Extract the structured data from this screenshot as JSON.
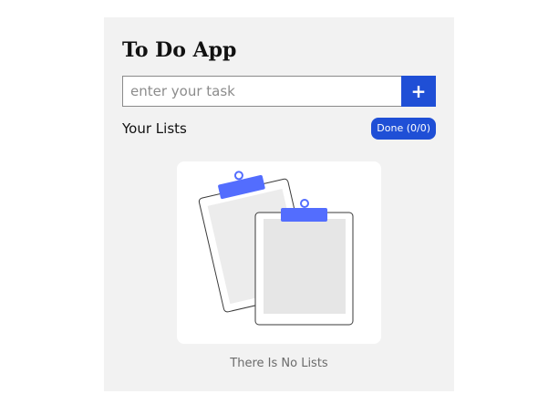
{
  "app": {
    "title": "To Do App"
  },
  "task_input": {
    "placeholder": "enter your task",
    "value": "",
    "add_label": "+"
  },
  "lists": {
    "heading": "Your Lists",
    "done_badge": "Done (0/0)"
  },
  "empty_state": {
    "illustration_icon": "clipboards-icon",
    "message": "There Is No Lists"
  },
  "colors": {
    "accent": "#1f4fd6",
    "clip_accent": "#536dfe",
    "card_bg": "#f2f2f2"
  }
}
